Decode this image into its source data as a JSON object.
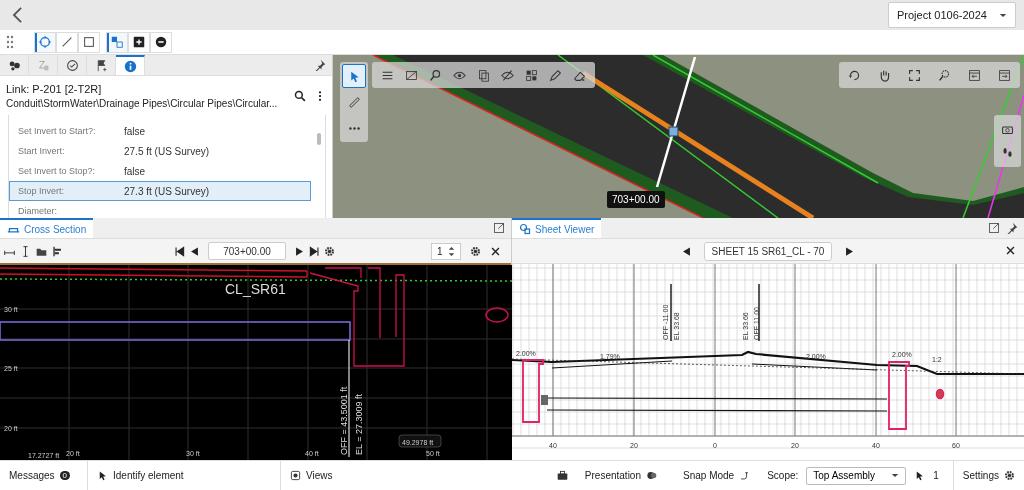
{
  "top_bar": {
    "project": "Project 0106-2024"
  },
  "toolbar": {
    "tools": [
      {
        "kind": "point",
        "selected": true
      },
      {
        "kind": "line",
        "selected": false
      },
      {
        "kind": "rect",
        "selected": false
      },
      {
        "kind": "group",
        "selected": true
      },
      {
        "kind": "add",
        "selected": false
      },
      {
        "kind": "remove",
        "selected": false
      }
    ]
  },
  "properties_panel": {
    "tabs": [
      {
        "kind": "elements",
        "selected": false
      },
      {
        "kind": "text",
        "selected": false
      },
      {
        "kind": "check",
        "selected": false
      },
      {
        "kind": "flag",
        "selected": false
      },
      {
        "kind": "info",
        "selected": true
      }
    ],
    "title": "Link: P-201 [2-T2R]",
    "path": "Conduit\\StormWater\\Drainage Pipes\\Circular Pipes\\Circular...",
    "rows": [
      {
        "label": "Set Invert to Start?:",
        "value": "false",
        "selected": false
      },
      {
        "label": "Start Invert:",
        "value": "27.5 ft (US Survey)",
        "selected": false
      },
      {
        "label": "Set Invert to Stop?:",
        "value": "false",
        "selected": false
      },
      {
        "label": "Stop Invert:",
        "value": "27.3 ft (US Survey)",
        "selected": true
      },
      {
        "label": "Diameter:",
        "selected": false
      }
    ]
  },
  "map": {
    "station_label": "703+00.00",
    "tools": [
      {
        "kind": "select",
        "selected": true
      },
      {
        "kind": "measure",
        "selected": false
      },
      {
        "kind": "more",
        "selected": false
      }
    ]
  },
  "cross_section": {
    "tab": "Cross Section",
    "station": "703+00.00",
    "page": "1",
    "alignment_label": "CL_SR61",
    "y_labels": [
      "30 ft",
      "25 ft",
      "20 ft"
    ],
    "x_labels": [
      "20 ft",
      "30 ft",
      "40 ft",
      "50 ft"
    ],
    "offset_label": "OFF = 43.5001 ft",
    "elevation_label": "EL = 27.3009 ft",
    "dimension_labels": [
      "49.2978 ft",
      "17.2727 ft"
    ]
  },
  "sheet_viewer": {
    "tab": "Sheet Viewer",
    "sheet": "SHEET 15 SR61_CL - 70",
    "x_labels": [
      "40",
      "20",
      "0",
      "20",
      "40",
      "60"
    ],
    "slope_labels": [
      "2.00%",
      "1.79%",
      "2.00%",
      "2.00%",
      "1:2"
    ],
    "callouts": [
      [
        "OFF -11.00",
        "EL 33.68"
      ],
      [
        "EL 33.66",
        "OFF 11.00"
      ]
    ]
  },
  "status_bar": {
    "messages": "Messages",
    "message_count": "0",
    "identify": "Identify element",
    "views": "Views",
    "presentation": "Presentation",
    "snap": "Snap Mode",
    "scope_label": "Scope:",
    "scope": "Top Assembly",
    "selection_count": "1",
    "settings": "Settings"
  }
}
